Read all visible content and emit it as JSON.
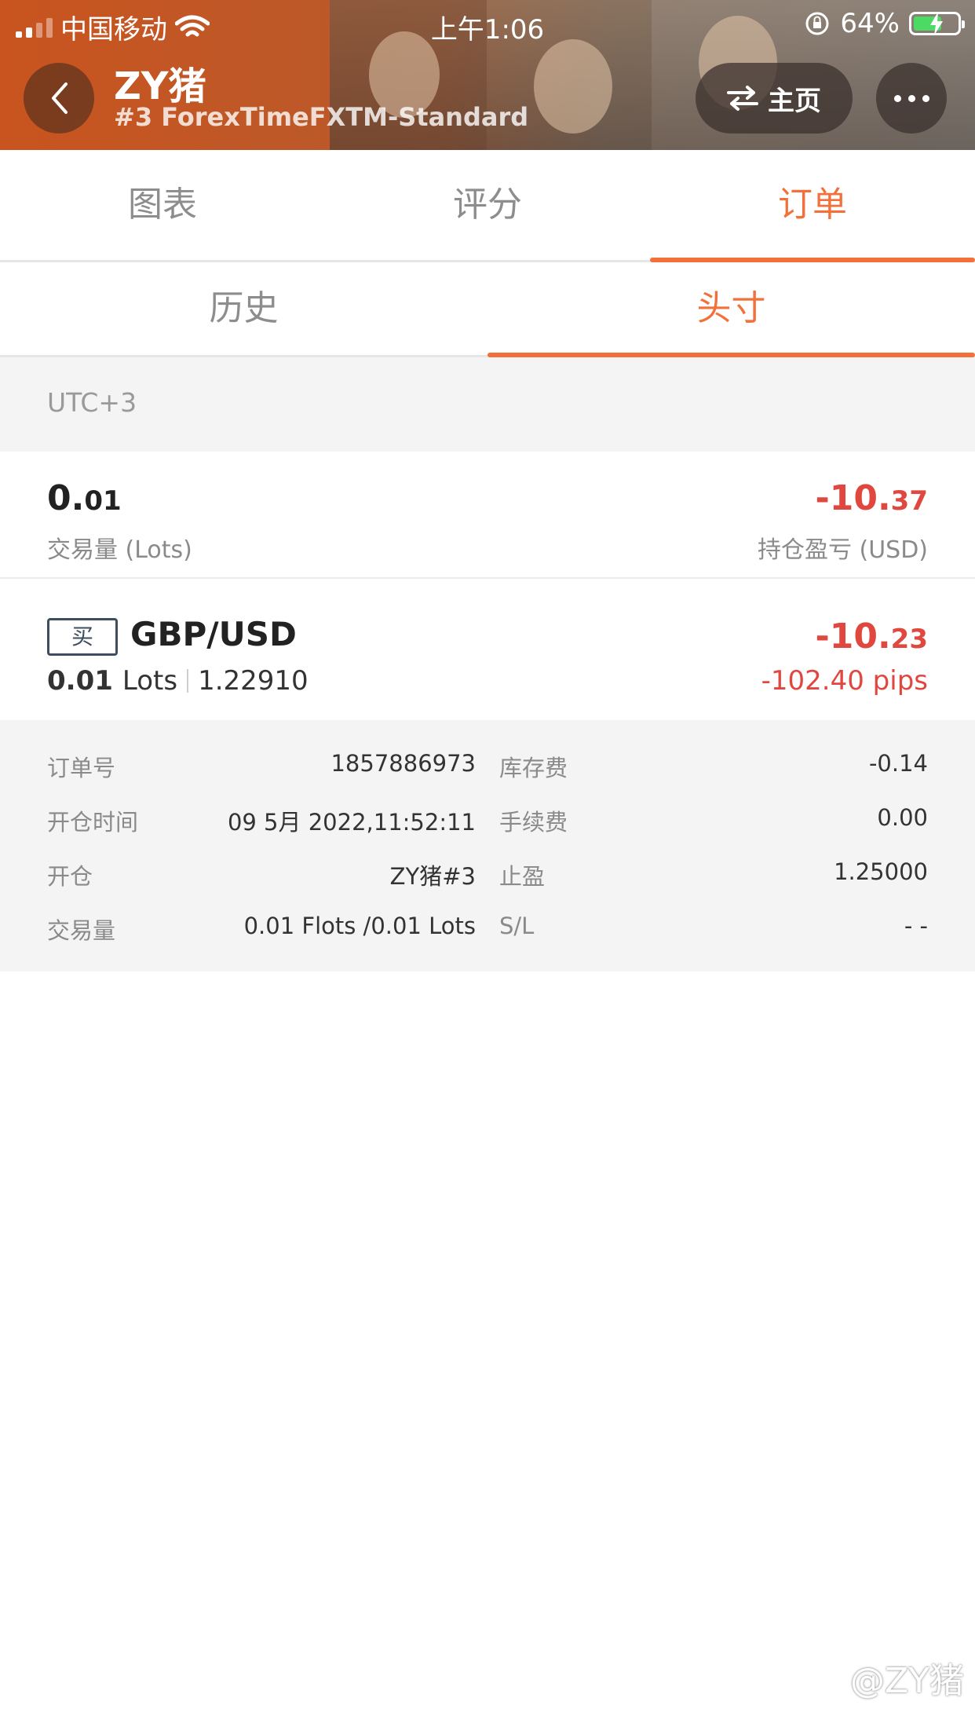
{
  "status_bar": {
    "carrier": "中国移动",
    "time": "上午1:06",
    "battery": "64%"
  },
  "header": {
    "title": "ZY猪",
    "subtitle": "#3 ForexTimeFXTM-Standard",
    "home_label": "主页"
  },
  "tabs": [
    {
      "label": "图表",
      "active": false
    },
    {
      "label": "评分",
      "active": false
    },
    {
      "label": "订单",
      "active": true
    }
  ],
  "subtabs": [
    {
      "label": "历史",
      "active": false
    },
    {
      "label": "头寸",
      "active": true
    }
  ],
  "timezone": "UTC+3",
  "summary": {
    "lots_int": "0.",
    "lots_dec": "01",
    "lots_label": "交易量 (Lots)",
    "pnl_int": "-10.",
    "pnl_dec": "37",
    "pnl_label": "持仓盈亏 (USD)"
  },
  "position": {
    "side": "买",
    "symbol": "GBP/USD",
    "lots_value": "0.01",
    "lots_unit": "Lots",
    "open_price": "1.22910",
    "pnl_int": "-10.",
    "pnl_dec": "23",
    "pips": "-102.40 pips"
  },
  "details": [
    {
      "k1": "订单号",
      "v1": "1857886973",
      "k2": "库存费",
      "v2": "-0.14"
    },
    {
      "k1": "开仓时间",
      "v1": "09 5月 2022,11:52:11",
      "k2": "手续费",
      "v2": "0.00"
    },
    {
      "k1": "开仓",
      "v1": "ZY猪#3",
      "k2": "止盈",
      "v2": "1.25000"
    },
    {
      "k1": "交易量",
      "v1": "0.01 Flots /0.01 Lots",
      "k2": "S/L",
      "v2": "- -"
    }
  ],
  "watermark": "@ZY猪",
  "colors": {
    "accent": "#f2713a",
    "loss": "#e0483f"
  }
}
